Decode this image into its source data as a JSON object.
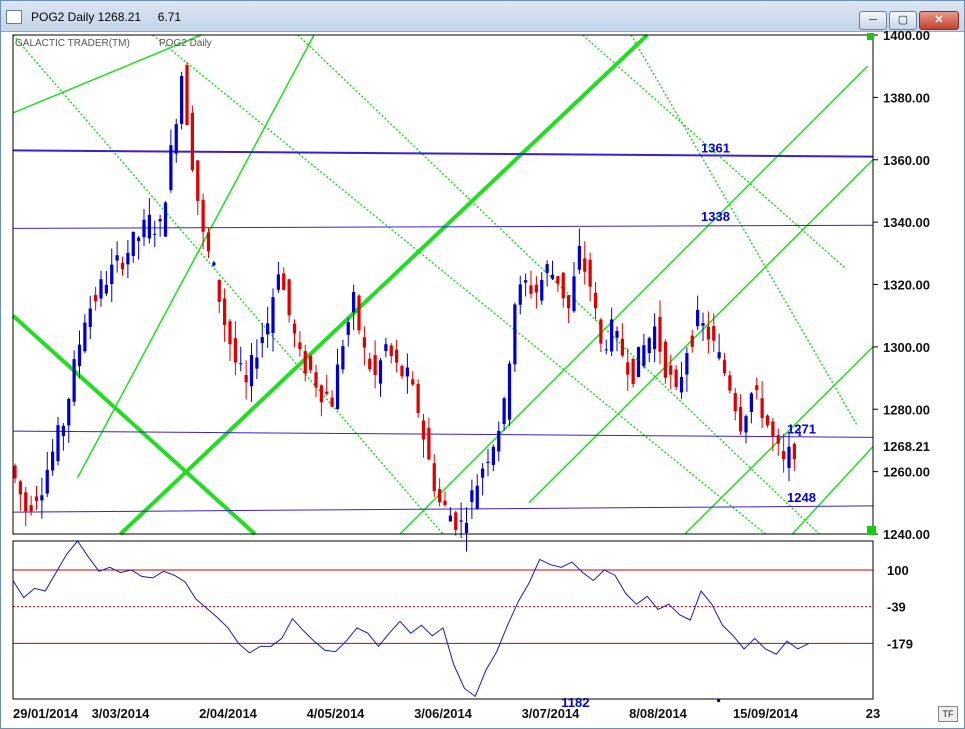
{
  "window": {
    "title": "POG2 Daily 1268.21     6.71",
    "buttons": {
      "minimize": "─",
      "maximize": "▢",
      "close": "✕"
    },
    "tf_label": "TF"
  },
  "chart_data": [
    {
      "type": "candlestick",
      "panel": "price",
      "labels": {
        "left": "GALACTIC TRADER(TM)",
        "symbol": "POG2 Daily"
      },
      "ylim": [
        1240,
        1400
      ],
      "y_ticks": [
        "1240.00",
        "1260.00",
        "1280.00",
        "1300.00",
        "1320.00",
        "1340.00",
        "1360.00",
        "1380.00",
        "1400.00"
      ],
      "y_tick_values": [
        1240,
        1260,
        1280,
        1300,
        1320,
        1340,
        1360,
        1380,
        1400
      ],
      "x_tick_labels": [
        "29/01/2014",
        "3/03/2014",
        "2/04/2014",
        "4/05/2014",
        "3/06/2014",
        "3/07/2014",
        "8/08/2014",
        "15/09/2014",
        "23"
      ],
      "x_tick_index": [
        0,
        20,
        40,
        60,
        80,
        100,
        120,
        140,
        160
      ],
      "n_bars": 160,
      "last_price_label": "1268.21",
      "last_price": 1268.21,
      "price_path": [
        [
          0,
          1262
        ],
        [
          3,
          1248
        ],
        [
          6,
          1256
        ],
        [
          10,
          1276
        ],
        [
          14,
          1310
        ],
        [
          18,
          1322
        ],
        [
          22,
          1331
        ],
        [
          26,
          1340
        ],
        [
          28,
          1338
        ],
        [
          30,
          1362
        ],
        [
          32,
          1388
        ],
        [
          34,
          1360
        ],
        [
          36,
          1335
        ],
        [
          38,
          1324
        ],
        [
          40,
          1308
        ],
        [
          42,
          1295
        ],
        [
          44,
          1287
        ],
        [
          46,
          1300
        ],
        [
          48,
          1308
        ],
        [
          50,
          1326
        ],
        [
          52,
          1310
        ],
        [
          54,
          1296
        ],
        [
          56,
          1292
        ],
        [
          58,
          1286
        ],
        [
          60,
          1283
        ],
        [
          62,
          1302
        ],
        [
          64,
          1314
        ],
        [
          66,
          1298
        ],
        [
          68,
          1290
        ],
        [
          70,
          1300
        ],
        [
          72,
          1293
        ],
        [
          74,
          1290
        ],
        [
          76,
          1280
        ],
        [
          78,
          1263
        ],
        [
          80,
          1250
        ],
        [
          82,
          1246
        ],
        [
          84,
          1243
        ],
        [
          86,
          1252
        ],
        [
          88,
          1262
        ],
        [
          90,
          1270
        ],
        [
          92,
          1280
        ],
        [
          94,
          1315
        ],
        [
          96,
          1320
        ],
        [
          98,
          1318
        ],
        [
          100,
          1325
        ],
        [
          102,
          1322
        ],
        [
          104,
          1312
        ],
        [
          106,
          1330
        ],
        [
          108,
          1320
        ],
        [
          110,
          1300
        ],
        [
          112,
          1305
        ],
        [
          114,
          1298
        ],
        [
          116,
          1292
        ],
        [
          118,
          1300
        ],
        [
          120,
          1306
        ],
        [
          122,
          1294
        ],
        [
          124,
          1284
        ],
        [
          126,
          1300
        ],
        [
          128,
          1308
        ],
        [
          130,
          1304
        ],
        [
          132,
          1296
        ],
        [
          134,
          1288
        ],
        [
          136,
          1276
        ],
        [
          138,
          1285
        ],
        [
          140,
          1280
        ],
        [
          142,
          1270
        ],
        [
          144,
          1262
        ],
        [
          146,
          1268
        ]
      ],
      "horizontal_levels": [
        {
          "label": "1361",
          "y_start": 1363,
          "y_end": 1361,
          "weight": "bold"
        },
        {
          "label": "1338",
          "y_start": 1338,
          "y_end": 1339,
          "weight": "normal"
        },
        {
          "label": "1271",
          "y_start": 1273,
          "y_end": 1271,
          "weight": "normal"
        },
        {
          "label": "1248",
          "y_start": 1247,
          "y_end": 1249,
          "weight": "normal"
        }
      ],
      "angle_lines_color": "#22dd22",
      "level_line_color": "#3a1fd0"
    },
    {
      "type": "line",
      "panel": "oscillator",
      "y_ticks": [
        "100",
        "-39",
        "-179"
      ],
      "y_tick_values": [
        100,
        -39,
        -179
      ],
      "ylim": [
        -390,
        210
      ],
      "levels": [
        100,
        -39,
        -179
      ],
      "bottom_label": "1182",
      "values": [
        [
          0,
          60
        ],
        [
          2,
          -5
        ],
        [
          4,
          30
        ],
        [
          6,
          20
        ],
        [
          8,
          90
        ],
        [
          10,
          160
        ],
        [
          12,
          210
        ],
        [
          14,
          150
        ],
        [
          16,
          95
        ],
        [
          18,
          110
        ],
        [
          20,
          90
        ],
        [
          22,
          100
        ],
        [
          24,
          75
        ],
        [
          26,
          70
        ],
        [
          28,
          95
        ],
        [
          30,
          80
        ],
        [
          32,
          55
        ],
        [
          34,
          -10
        ],
        [
          36,
          -45
        ],
        [
          38,
          -80
        ],
        [
          40,
          -120
        ],
        [
          42,
          -180
        ],
        [
          44,
          -215
        ],
        [
          46,
          -190
        ],
        [
          48,
          -190
        ],
        [
          50,
          -160
        ],
        [
          52,
          -85
        ],
        [
          54,
          -130
        ],
        [
          56,
          -170
        ],
        [
          58,
          -205
        ],
        [
          60,
          -210
        ],
        [
          62,
          -170
        ],
        [
          64,
          -120
        ],
        [
          66,
          -140
        ],
        [
          68,
          -190
        ],
        [
          70,
          -140
        ],
        [
          72,
          -95
        ],
        [
          74,
          -140
        ],
        [
          76,
          -110
        ],
        [
          78,
          -150
        ],
        [
          80,
          -120
        ],
        [
          82,
          -260
        ],
        [
          84,
          -350
        ],
        [
          86,
          -380
        ],
        [
          88,
          -280
        ],
        [
          90,
          -210
        ],
        [
          92,
          -110
        ],
        [
          94,
          -20
        ],
        [
          96,
          50
        ],
        [
          98,
          140
        ],
        [
          100,
          120
        ],
        [
          102,
          110
        ],
        [
          104,
          130
        ],
        [
          106,
          90
        ],
        [
          108,
          60
        ],
        [
          110,
          100
        ],
        [
          112,
          80
        ],
        [
          114,
          10
        ],
        [
          116,
          -30
        ],
        [
          118,
          0
        ],
        [
          120,
          -50
        ],
        [
          122,
          -30
        ],
        [
          124,
          -70
        ],
        [
          126,
          -90
        ],
        [
          128,
          20
        ],
        [
          130,
          -30
        ],
        [
          132,
          -110
        ],
        [
          134,
          -150
        ],
        [
          136,
          -200
        ],
        [
          138,
          -160
        ],
        [
          140,
          -200
        ],
        [
          142,
          -220
        ],
        [
          144,
          -170
        ],
        [
          146,
          -200
        ],
        [
          148,
          -180
        ]
      ]
    }
  ]
}
